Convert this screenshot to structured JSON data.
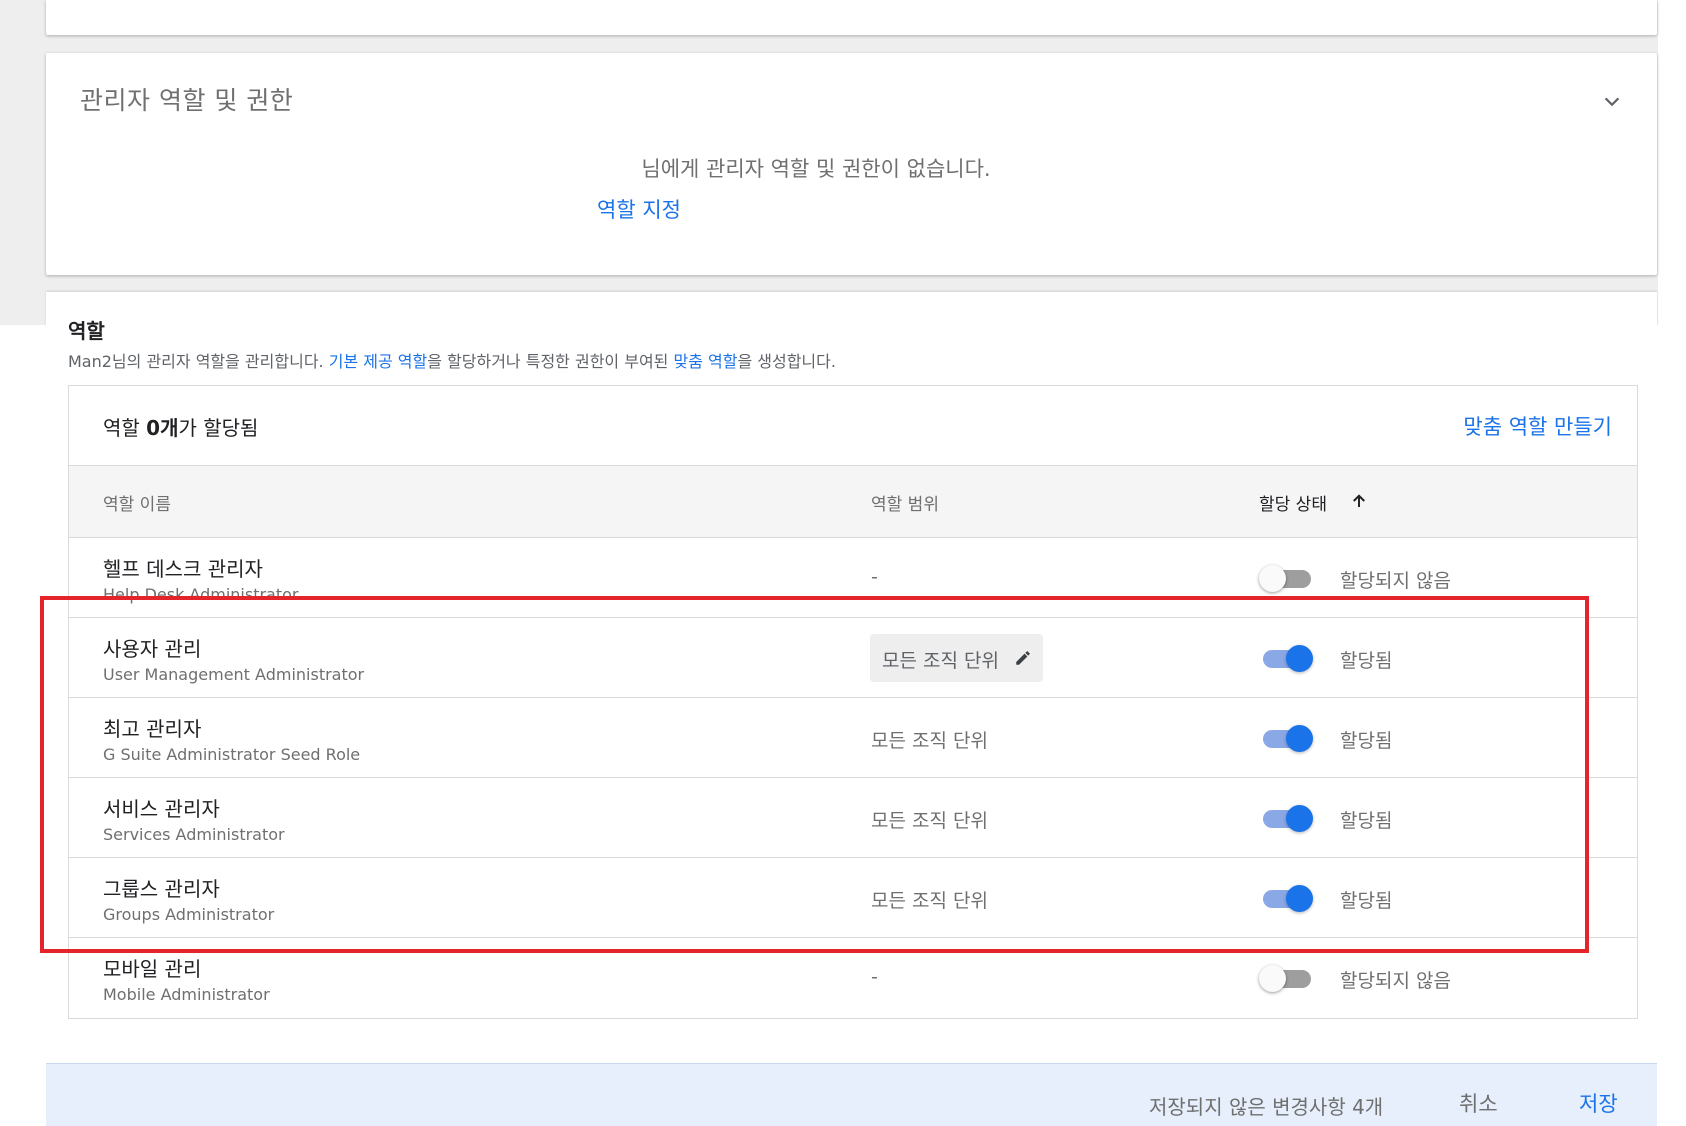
{
  "admin_section": {
    "title": "관리자 역할 및 권한",
    "empty_message": "님에게 관리자 역할 및 권한이 없습니다.",
    "assign_link": "역할 지정"
  },
  "roles_section": {
    "heading": "역할",
    "desc_prefix": "Man2님의 관리자 역할을 관리합니다.",
    "desc_link1": "기본 제공 역할",
    "desc_middle": "을 할당하거나 특정한 권한이 부여된",
    "desc_link2": "맞춤 역할",
    "desc_suffix": "을 생성합니다.",
    "assigned_prefix": "역할",
    "assigned_count": "0개",
    "assigned_suffix": "가 할당됨",
    "create_link": "맞춤 역할 만들기",
    "columns": {
      "name": "역할 이름",
      "scope": "역할 범위",
      "status": "할당 상태"
    },
    "rows": [
      {
        "name": "헬프 데스크 관리자",
        "subtitle": "Help Desk Administrator",
        "scope": "-",
        "assigned": false,
        "status": "할당되지 않음"
      },
      {
        "name": "사용자 관리",
        "subtitle": "User Management Administrator",
        "scope": "모든 조직 단위",
        "scope_editable": true,
        "assigned": true,
        "status": "할당됨"
      },
      {
        "name": "최고 관리자",
        "subtitle": "G Suite Administrator Seed Role",
        "scope": "모든 조직 단위",
        "assigned": true,
        "status": "할당됨"
      },
      {
        "name": "서비스 관리자",
        "subtitle": "Services Administrator",
        "scope": "모든 조직 단위",
        "assigned": true,
        "status": "할당됨"
      },
      {
        "name": "그룹스 관리자",
        "subtitle": "Groups Administrator",
        "scope": "모든 조직 단위",
        "assigned": true,
        "status": "할당됨"
      },
      {
        "name": "모바일 관리",
        "subtitle": "Mobile Administrator",
        "scope": "-",
        "assigned": false,
        "status": "할당되지 않음"
      }
    ]
  },
  "footer": {
    "unsaved": "저장되지 않은 변경사항 4개",
    "cancel": "취소",
    "save": "저장"
  },
  "colors": {
    "accent": "#1a73e8",
    "highlight": "#e3242b",
    "footer_bg": "#e6effb"
  },
  "icons": [
    "chevron-down-icon",
    "arrow-up-icon",
    "pencil-icon"
  ]
}
